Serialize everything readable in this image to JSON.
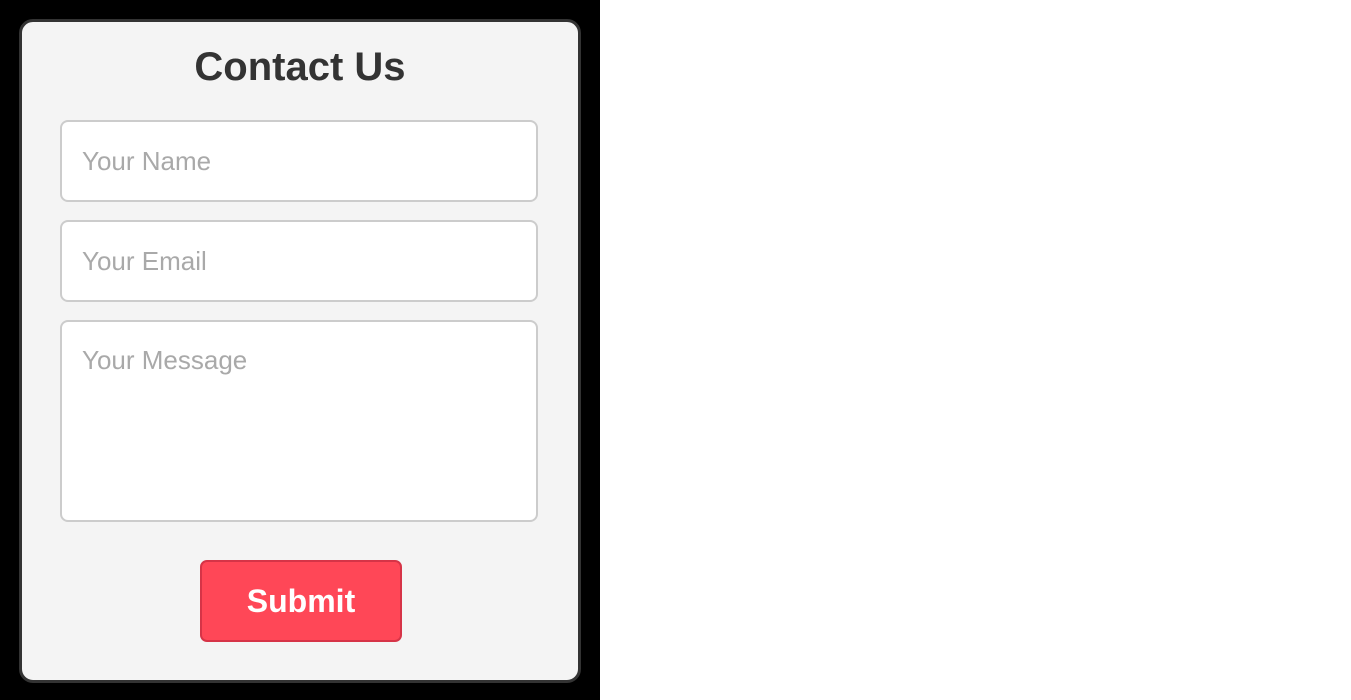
{
  "form": {
    "title": "Contact Us",
    "name_placeholder": "Your Name",
    "email_placeholder": "Your Email",
    "message_placeholder": "Your Message",
    "submit_label": "Submit"
  },
  "colors": {
    "panel_background": "#000000",
    "card_background": "#f4f4f4",
    "card_border": "#333333",
    "field_border": "#cccccc",
    "submit_background": "#ff4757",
    "submit_text": "#ffffff",
    "title_text": "#333333"
  }
}
